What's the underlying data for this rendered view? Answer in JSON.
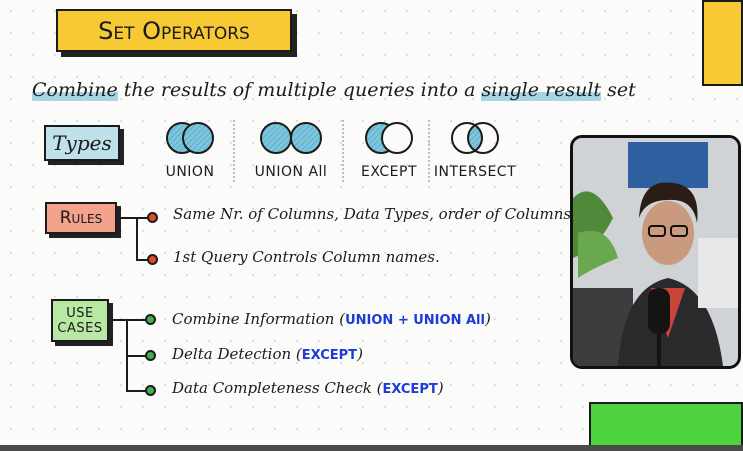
{
  "title": "Set Operators",
  "subtitle": {
    "part1": "Combine",
    "part2": " the results of multiple queries into a ",
    "part3": "single result",
    "part4": " set"
  },
  "types": {
    "label": "Types",
    "operators": [
      {
        "label": "UNION"
      },
      {
        "label": "UNION All"
      },
      {
        "label": "EXCEPT"
      },
      {
        "label": "INTERSECT"
      }
    ]
  },
  "rules": {
    "label": "Rules",
    "items": [
      "Same Nr. of Columns, Data Types, order of Columns.",
      "1st Query Controls Column names."
    ]
  },
  "use_cases": {
    "label_line1": "USE",
    "label_line2": "CASES",
    "items": [
      {
        "text": "Combine Information (",
        "ops": "UNION + UNION All",
        "close": ")"
      },
      {
        "text": "Delta Detection (",
        "ops": "EXCEPT",
        "close": ")"
      },
      {
        "text": "Data Completeness Check (",
        "ops": "EXCEPT",
        "close": ")"
      }
    ]
  },
  "colors": {
    "yellow": "#f7c933",
    "blue_tag": "#bfe1ec",
    "red_tag": "#f3a28c",
    "green_tag": "#b9e7a4",
    "venn_fill": "#7ec6dd",
    "op_text_blue": "#1e3bd6"
  }
}
